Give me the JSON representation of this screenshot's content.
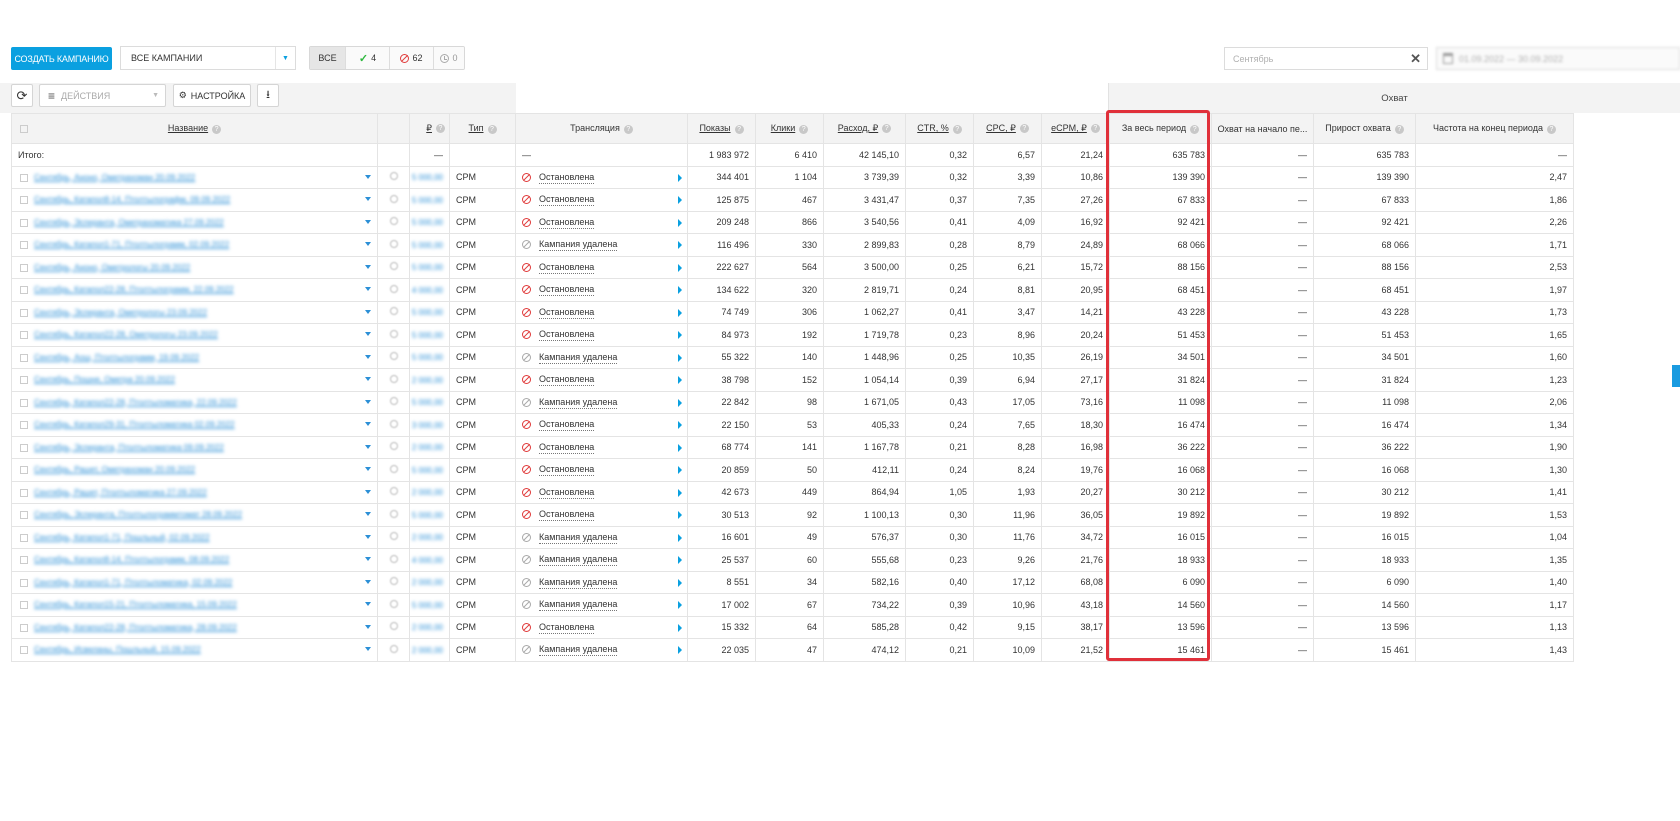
{
  "toolbar": {
    "create_label": "СОЗДАТЬ КАМПАНИЮ",
    "campaign_select": "ВСЕ КАМПАНИИ",
    "filter_all": "ВСЕ",
    "filter_active_count": "4",
    "filter_stopped_count": "62",
    "filter_waiting_count": "0",
    "search_value": "Сентябрь",
    "date_range": "01.09.2022 — 30.09.2022"
  },
  "subtoolbar": {
    "actions_placeholder": "ДЕЙСТВИЯ",
    "settings_label": "НАСТРОЙКА"
  },
  "group_header": "Охват",
  "columns": {
    "name": "Название",
    "budget": "₽",
    "type": "Тип",
    "broadcast": "Трансляция",
    "impressions": "Показы",
    "clicks": "Клики",
    "spend": "Расход, ₽",
    "ctr": "CTR, %",
    "cpc": "CPC, ₽",
    "ecpm": "eCPM, ₽",
    "reach_total": "За весь период",
    "reach_start": "Охват на начало пе...",
    "reach_growth": "Прирост охвата",
    "freq_end": "Частота на конец периода"
  },
  "total": {
    "label": "Итого:",
    "budget": "—",
    "broadcast": "—",
    "impressions": "1 983 972",
    "clicks": "6 410",
    "spend": "42 145,10",
    "ctr": "0,32",
    "cpc": "6,57",
    "ecpm": "21,24",
    "reach_total": "635 783",
    "reach_start": "—",
    "reach_growth": "635 783",
    "freq_end": "—"
  },
  "status_labels": {
    "stopped": "Остановлена",
    "deleted": "Кампания удалена"
  },
  "rows": [
    {
      "name": "Сентябрь, Аноно, Ометрахоман 20.09.2022",
      "budget": "5 000,00",
      "type": "CPM",
      "status": "stopped",
      "status_text": "Остановлена",
      "impressions": "344 401",
      "clicks": "1 104",
      "spend": "3 739,39",
      "ctr": "0,32",
      "cpc": "3,39",
      "ecpm": "10,86",
      "reach_total": "139 390",
      "reach_start": "—",
      "reach_growth": "139 390",
      "freq_end": "2,47"
    },
    {
      "name": "Сентябрь, Катапол8-14, Птолтылографм, 09.09.2022",
      "budget": "5 000,00",
      "type": "CPM",
      "status": "stopped",
      "status_text": "Остановлена",
      "impressions": "125 875",
      "clicks": "467",
      "spend": "3 431,47",
      "ctr": "0,37",
      "cpc": "7,35",
      "ecpm": "27,26",
      "reach_total": "67 833",
      "reach_start": "—",
      "reach_growth": "67 833",
      "freq_end": "1,86"
    },
    {
      "name": "Сентябрь, Эсперанта, Ометрахоматика 27.09.2022",
      "budget": "5 000,00",
      "type": "CPM",
      "status": "stopped",
      "status_text": "Остановлена",
      "impressions": "209 248",
      "clicks": "866",
      "spend": "3 540,56",
      "ctr": "0,41",
      "cpc": "4,09",
      "ecpm": "16,92",
      "reach_total": "92 421",
      "reach_start": "—",
      "reach_growth": "92 421",
      "freq_end": "2,26"
    },
    {
      "name": "Сентябрь, Катапол1-71, Птолтылограмм, 02.09.2022",
      "budget": "5 000,00",
      "type": "CPM",
      "status": "deleted",
      "status_text": "Кампания удалена",
      "impressions": "116 496",
      "clicks": "330",
      "spend": "2 899,83",
      "ctr": "0,28",
      "cpc": "8,79",
      "ecpm": "24,89",
      "reach_total": "68 066",
      "reach_start": "—",
      "reach_growth": "68 066",
      "freq_end": "1,71"
    },
    {
      "name": "Сентябрь, Аноно, Ометрологы 20.09.2022",
      "budget": "5 000,00",
      "type": "CPM",
      "status": "stopped",
      "status_text": "Остановлена",
      "impressions": "222 627",
      "clicks": "564",
      "spend": "3 500,00",
      "ctr": "0,25",
      "cpc": "6,21",
      "ecpm": "15,72",
      "reach_total": "88 156",
      "reach_start": "—",
      "reach_growth": "88 156",
      "freq_end": "2,53"
    },
    {
      "name": "Сентябрь, Катапол22-28, Птолтылограмм, 22.09.2022",
      "budget": "4 000,00",
      "type": "CPM",
      "status": "stopped",
      "status_text": "Остановлена",
      "impressions": "134 622",
      "clicks": "320",
      "spend": "2 819,71",
      "ctr": "0,24",
      "cpc": "8,81",
      "ecpm": "20,95",
      "reach_total": "68 451",
      "reach_start": "—",
      "reach_growth": "68 451",
      "freq_end": "1,97"
    },
    {
      "name": "Сентябрь, Эсперанта, Ометрологы 23.09.2022",
      "budget": "5 000,00",
      "type": "CPM",
      "status": "stopped",
      "status_text": "Остановлена",
      "impressions": "74 749",
      "clicks": "306",
      "spend": "1 062,27",
      "ctr": "0,41",
      "cpc": "3,47",
      "ecpm": "14,21",
      "reach_total": "43 228",
      "reach_start": "—",
      "reach_growth": "43 228",
      "freq_end": "1,73"
    },
    {
      "name": "Сентябрь, Катапол22-28, Ометрологы 23.09.2022",
      "budget": "5 000,00",
      "type": "CPM",
      "status": "stopped",
      "status_text": "Остановлена",
      "impressions": "84 973",
      "clicks": "192",
      "spend": "1 719,78",
      "ctr": "0,23",
      "cpc": "8,96",
      "ecpm": "20,24",
      "reach_total": "51 453",
      "reach_start": "—",
      "reach_growth": "51 453",
      "freq_end": "1,65"
    },
    {
      "name": "Сентябрь, Аош, Птолтылограмм, 19.09.2022",
      "budget": "5 000,00",
      "type": "CPM",
      "status": "deleted",
      "status_text": "Кампания удалена",
      "impressions": "55 322",
      "clicks": "140",
      "spend": "1 448,96",
      "ctr": "0,25",
      "cpc": "10,35",
      "ecpm": "26,19",
      "reach_total": "34 501",
      "reach_start": "—",
      "reach_growth": "34 501",
      "freq_end": "1,60"
    },
    {
      "name": "Сентябрь, Пошне, Ометра 20.09.2022",
      "budget": "2 000,00",
      "type": "CPM",
      "status": "stopped",
      "status_text": "Остановлена",
      "impressions": "38 798",
      "clicks": "152",
      "spend": "1 054,14",
      "ctr": "0,39",
      "cpc": "6,94",
      "ecpm": "27,17",
      "reach_total": "31 824",
      "reach_start": "—",
      "reach_growth": "31 824",
      "freq_end": "1,23"
    },
    {
      "name": "Сентябрь, Катапол22-28, Птолтыломатика, 22.09.2022",
      "budget": "5 000,00",
      "type": "CPM",
      "status": "deleted",
      "status_text": "Кампания удалена",
      "impressions": "22 842",
      "clicks": "98",
      "spend": "1 671,05",
      "ctr": "0,43",
      "cpc": "17,05",
      "ecpm": "73,16",
      "reach_total": "11 098",
      "reach_start": "—",
      "reach_growth": "11 098",
      "freq_end": "2,06"
    },
    {
      "name": "Сентябрь, Катапол29-31, Птолтыломатика 02.09.2022",
      "budget": "3 000,00",
      "type": "CPM",
      "status": "stopped",
      "status_text": "Остановлена",
      "impressions": "22 150",
      "clicks": "53",
      "spend": "405,33",
      "ctr": "0,24",
      "cpc": "7,65",
      "ecpm": "18,30",
      "reach_total": "16 474",
      "reach_start": "—",
      "reach_growth": "16 474",
      "freq_end": "1,34"
    },
    {
      "name": "Сентябрь, Эсперанта, Птолтыломатика 09.09.2022",
      "budget": "2 000,00",
      "type": "CPM",
      "status": "stopped",
      "status_text": "Остановлена",
      "impressions": "68 774",
      "clicks": "141",
      "spend": "1 167,78",
      "ctr": "0,21",
      "cpc": "8,28",
      "ecpm": "16,98",
      "reach_total": "36 222",
      "reach_start": "—",
      "reach_growth": "36 222",
      "freq_end": "1,90"
    },
    {
      "name": "Сентябрь, Рашет, Ометрахоман 20.09.2022",
      "budget": "5 000,00",
      "type": "CPM",
      "status": "stopped",
      "status_text": "Остановлена",
      "impressions": "20 859",
      "clicks": "50",
      "spend": "412,11",
      "ctr": "0,24",
      "cpc": "8,24",
      "ecpm": "19,76",
      "reach_total": "16 068",
      "reach_start": "—",
      "reach_growth": "16 068",
      "freq_end": "1,30"
    },
    {
      "name": "Сентябрь, Рашет, Птолтыломатика 27.09.2022",
      "budget": "2 000,00",
      "type": "CPM",
      "status": "stopped",
      "status_text": "Остановлена",
      "impressions": "42 673",
      "clicks": "449",
      "spend": "864,94",
      "ctr": "1,05",
      "cpc": "1,93",
      "ecpm": "20,27",
      "reach_total": "30 212",
      "reach_start": "—",
      "reach_growth": "30 212",
      "freq_end": "1,41"
    },
    {
      "name": "Сентябрь, Эсперанта, Птолтылограммтомат 28.09.2022",
      "budget": "5 000,00",
      "type": "CPM",
      "status": "stopped",
      "status_text": "Остановлена",
      "impressions": "30 513",
      "clicks": "92",
      "spend": "1 100,13",
      "ctr": "0,30",
      "cpc": "11,96",
      "ecpm": "36,05",
      "reach_total": "19 892",
      "reach_start": "—",
      "reach_growth": "19 892",
      "freq_end": "1,53"
    },
    {
      "name": "Сентябрь, Катапол1-71, Пошльный, 02.09.2022",
      "budget": "2 000,00",
      "type": "CPM",
      "status": "deleted",
      "status_text": "Кампания удалена",
      "impressions": "16 601",
      "clicks": "49",
      "spend": "576,37",
      "ctr": "0,30",
      "cpc": "11,76",
      "ecpm": "34,72",
      "reach_total": "16 015",
      "reach_start": "—",
      "reach_growth": "16 015",
      "freq_end": "1,04"
    },
    {
      "name": "Сентябрь, Катапол8-14, Птолтылограмм, 08.09.2022",
      "budget": "4 000,00",
      "type": "CPM",
      "status": "deleted",
      "status_text": "Кампания удалена",
      "impressions": "25 537",
      "clicks": "60",
      "spend": "555,68",
      "ctr": "0,23",
      "cpc": "9,26",
      "ecpm": "21,76",
      "reach_total": "18 933",
      "reach_start": "—",
      "reach_growth": "18 933",
      "freq_end": "1,35"
    },
    {
      "name": "Сентябрь, Катапол1-71, Птолтыломатика, 02.09.2022",
      "budget": "2 000,00",
      "type": "CPM",
      "status": "deleted",
      "status_text": "Кампания удалена",
      "impressions": "8 551",
      "clicks": "34",
      "spend": "582,16",
      "ctr": "0,40",
      "cpc": "17,12",
      "ecpm": "68,08",
      "reach_total": "6 090",
      "reach_start": "—",
      "reach_growth": "6 090",
      "freq_end": "1,40"
    },
    {
      "name": "Сентябрь, Катапол15-21, Птолтыломатика, 15.09.2022",
      "budget": "5 000,00",
      "type": "CPM",
      "status": "deleted",
      "status_text": "Кампания удалена",
      "impressions": "17 002",
      "clicks": "67",
      "spend": "734,22",
      "ctr": "0,39",
      "cpc": "10,96",
      "ecpm": "43,18",
      "reach_total": "14 560",
      "reach_start": "—",
      "reach_growth": "14 560",
      "freq_end": "1,17"
    },
    {
      "name": "Сентябрь, Катапол22-28, Птолтыломатика, 28.09.2022",
      "budget": "2 000,00",
      "type": "CPM",
      "status": "stopped",
      "status_text": "Остановлена",
      "impressions": "15 332",
      "clicks": "64",
      "spend": "585,28",
      "ctr": "0,42",
      "cpc": "9,15",
      "ecpm": "38,17",
      "reach_total": "13 596",
      "reach_start": "—",
      "reach_growth": "13 596",
      "freq_end": "1,13"
    },
    {
      "name": "Сентябрь, Исвеланы, Пошльный, 15.09.2022",
      "budget": "2 000,00",
      "type": "CPM",
      "status": "deleted",
      "status_text": "Кампания удалена",
      "impressions": "22 035",
      "clicks": "47",
      "spend": "474,12",
      "ctr": "0,21",
      "cpc": "10,09",
      "ecpm": "21,52",
      "reach_total": "15 461",
      "reach_start": "—",
      "reach_growth": "15 461",
      "freq_end": "1,43"
    }
  ],
  "colors": {
    "accent": "#0aa0e0",
    "highlight": "#e0303a",
    "stopped": "#e03b3b",
    "deleted": "#aaaaaa"
  }
}
